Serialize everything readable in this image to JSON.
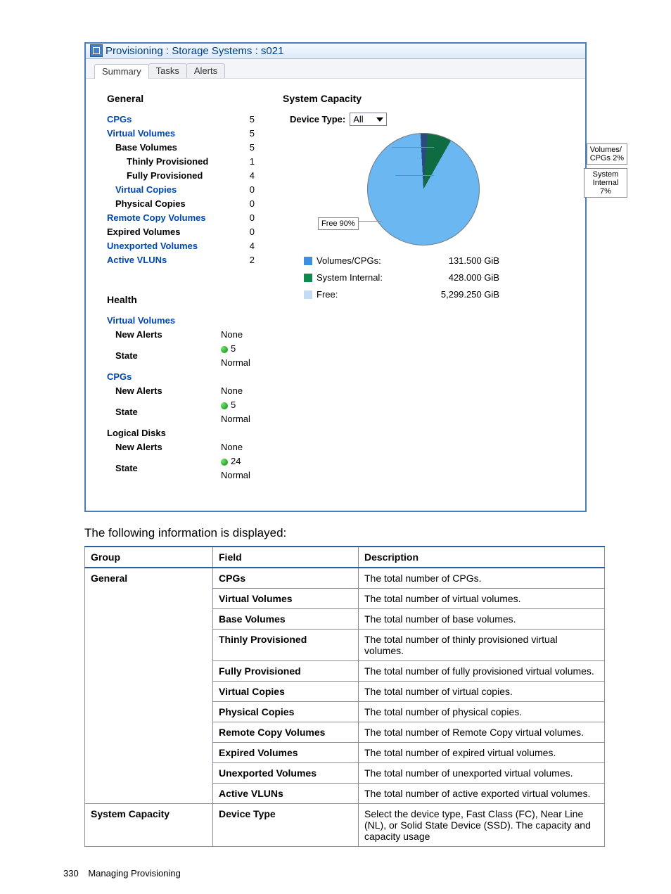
{
  "window": {
    "title": "Provisioning : Storage Systems : s021"
  },
  "tabs": [
    "Summary",
    "Tasks",
    "Alerts"
  ],
  "general": {
    "heading": "General",
    "items": [
      {
        "label": "CPGs",
        "value": "5",
        "class": "link"
      },
      {
        "label": "Virtual Volumes",
        "value": "5",
        "class": "link"
      },
      {
        "label": "Base Volumes",
        "value": "5",
        "class": "black indent1"
      },
      {
        "label": "Thinly Provisioned",
        "value": "1",
        "class": "black indent2"
      },
      {
        "label": "Fully Provisioned",
        "value": "4",
        "class": "black indent2"
      },
      {
        "label": "Virtual Copies",
        "value": "0",
        "class": "link indent1"
      },
      {
        "label": "Physical Copies",
        "value": "0",
        "class": "black indent1"
      },
      {
        "label": "Remote Copy Volumes",
        "value": "0",
        "class": "link"
      },
      {
        "label": "Expired Volumes",
        "value": "0",
        "class": "black"
      },
      {
        "label": "Unexported Volumes",
        "value": "4",
        "class": "link"
      },
      {
        "label": "Active VLUNs",
        "value": "2",
        "class": "link"
      }
    ]
  },
  "capacity": {
    "heading": "System Capacity",
    "device_label": "Device Type:",
    "device_value": "All",
    "callouts": {
      "free": "Free 90%",
      "vcpg": "Volumes/\nCPGs 2%",
      "sysint": "System\nInternal\n7%"
    },
    "legend": [
      {
        "sw": "blue",
        "label": "Volumes/CPGs:",
        "value": "131.500 GiB"
      },
      {
        "sw": "green",
        "label": "System Internal:",
        "value": "428.000 GiB"
      },
      {
        "sw": "light",
        "label": "Free:",
        "value": "5,299.250 GiB"
      }
    ]
  },
  "chart_data": {
    "type": "pie",
    "title": "System Capacity",
    "series": [
      {
        "name": "Volumes/CPGs",
        "value_gib": 131.5,
        "percent": 2
      },
      {
        "name": "System Internal",
        "value_gib": 428.0,
        "percent": 7
      },
      {
        "name": "Free",
        "value_gib": 5299.25,
        "percent": 90
      }
    ]
  },
  "health": {
    "heading": "Health",
    "groups": [
      {
        "title": "Virtual Volumes",
        "alerts": "None",
        "state": "5 Normal"
      },
      {
        "title": "CPGs",
        "alerts": "None",
        "state": "5 Normal"
      },
      {
        "title": "Logical Disks",
        "alerts": "None",
        "state": "24 Normal"
      }
    ],
    "labels": {
      "new_alerts": "New Alerts",
      "state": "State"
    }
  },
  "doc_intro": "The following information is displayed:",
  "desc_table": {
    "headers": [
      "Group",
      "Field",
      "Description"
    ],
    "rows": [
      {
        "group": "General",
        "field": "CPGs",
        "desc": "The total number of CPGs."
      },
      {
        "group": "",
        "field": "Virtual Volumes",
        "desc": "The total number of virtual volumes."
      },
      {
        "group": "",
        "field": "Base Volumes",
        "desc": "The total number of base volumes."
      },
      {
        "group": "",
        "field": "Thinly Provisioned",
        "desc": "The total number of thinly provisioned virtual volumes."
      },
      {
        "group": "",
        "field": "Fully Provisioned",
        "desc": "The total number of fully provisioned virtual volumes."
      },
      {
        "group": "",
        "field": "Virtual Copies",
        "desc": "The total number of virtual copies."
      },
      {
        "group": "",
        "field": "Physical Copies",
        "desc": "The total number of physical copies."
      },
      {
        "group": "",
        "field": "Remote Copy Volumes",
        "desc": "The total number of Remote Copy virtual volumes."
      },
      {
        "group": "",
        "field": "Expired Volumes",
        "desc": "The total number of expired virtual volumes."
      },
      {
        "group": "",
        "field": "Unexported Volumes",
        "desc": "The total number of unexported virtual volumes."
      },
      {
        "group": "",
        "field": "Active VLUNs",
        "desc": "The total number of active exported virtual volumes."
      },
      {
        "group": "System Capacity",
        "field": "Device Type",
        "desc": "Select the device type, Fast Class (FC), Near Line (NL), or Solid State Device (SSD). The capacity and capacity usage"
      }
    ]
  },
  "footer": {
    "page": "330",
    "section": "Managing Provisioning"
  }
}
